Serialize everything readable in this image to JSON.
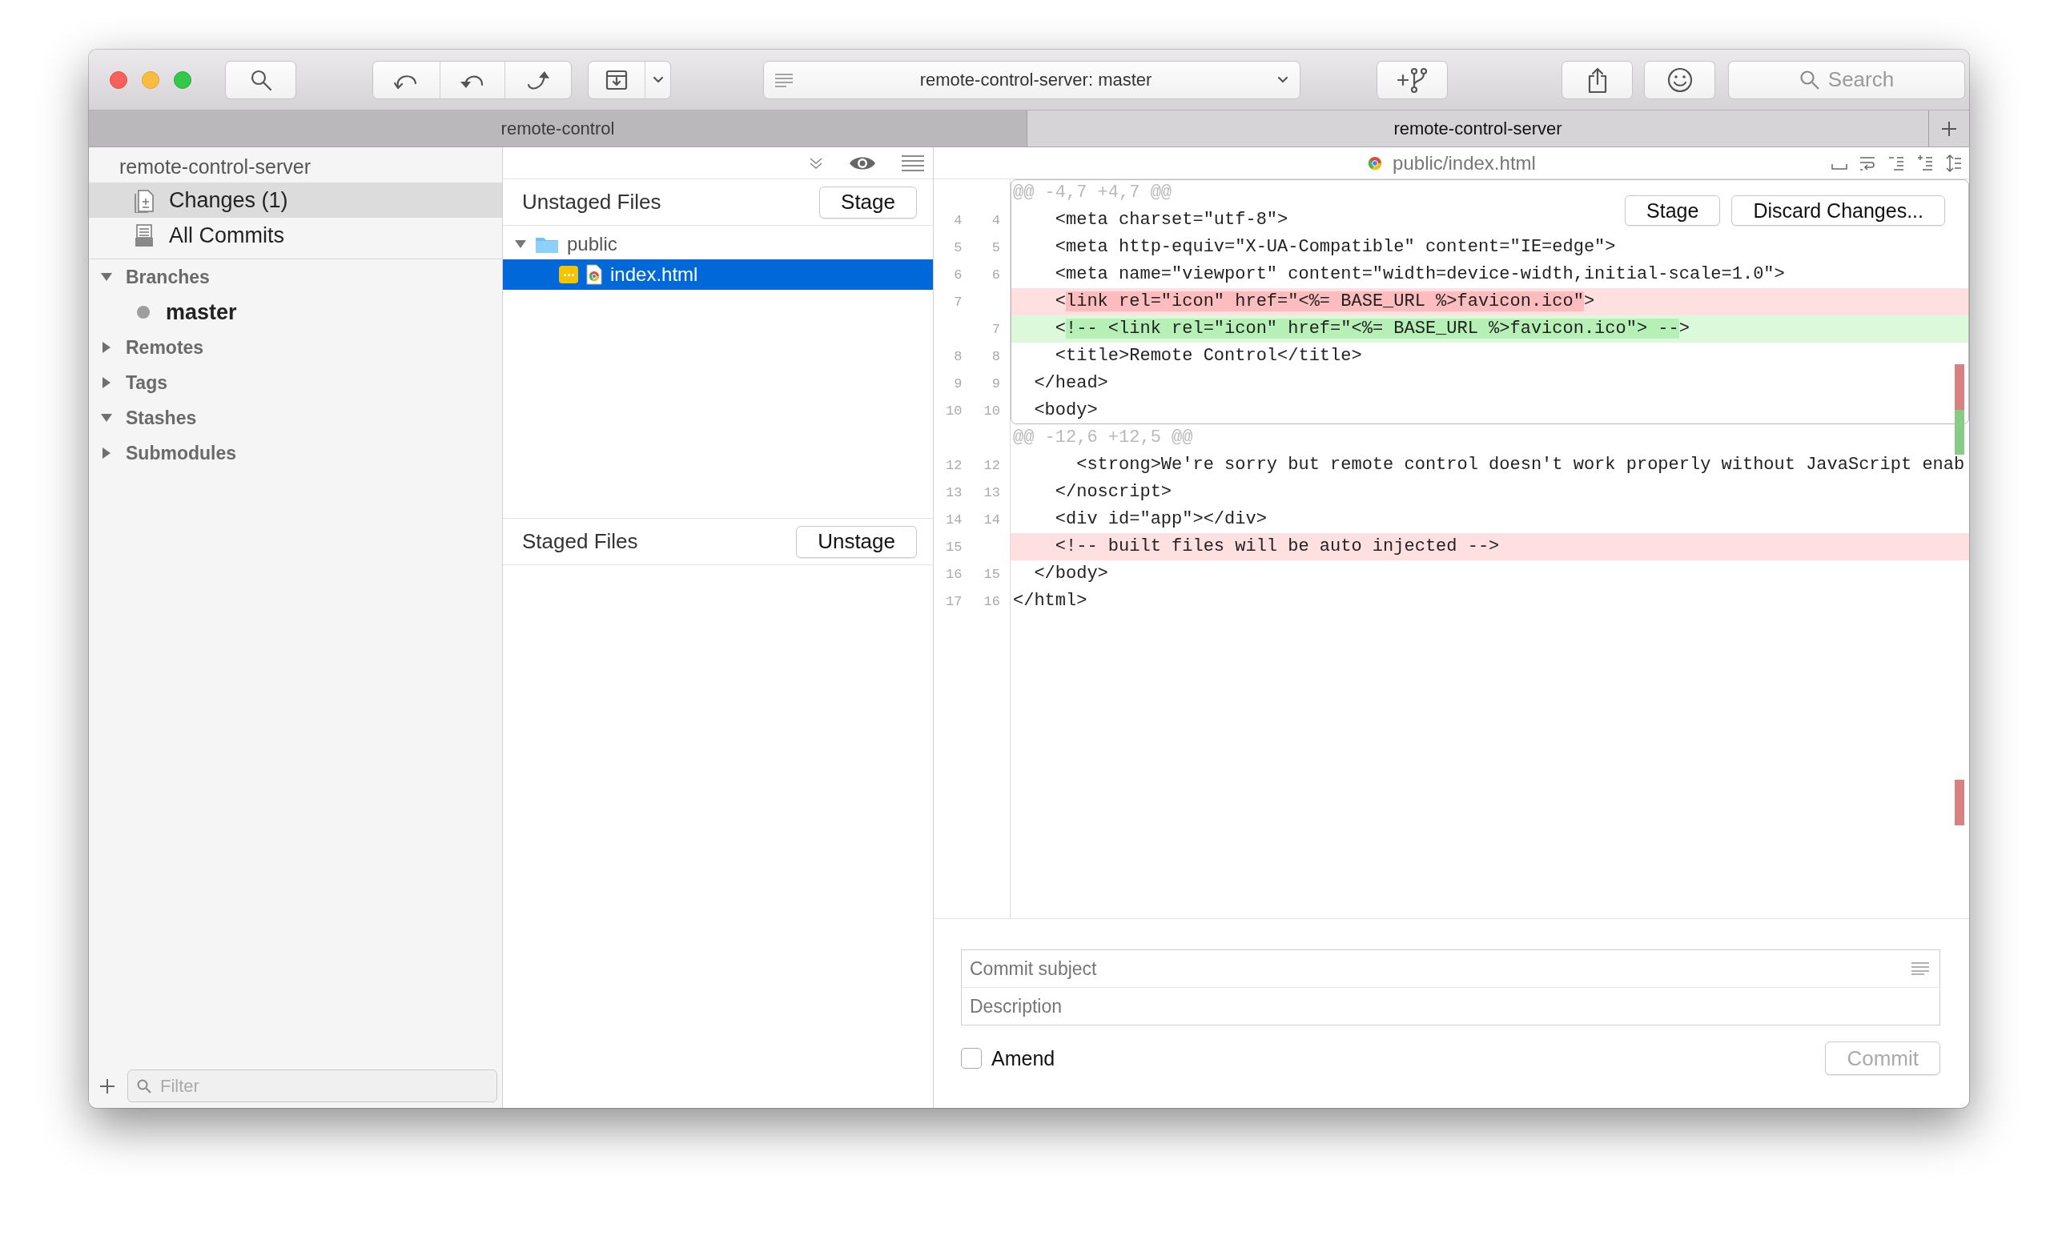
{
  "toolbar": {
    "branch_selector": "remote-control-server: master",
    "search": {
      "placeholder": "Search"
    }
  },
  "tabs": [
    {
      "label": "remote-control",
      "selected": false
    },
    {
      "label": "remote-control-server",
      "selected": true
    }
  ],
  "sidebar": {
    "repository": "remote-control-server",
    "items": [
      {
        "label": "Changes (1)",
        "kind": "changes",
        "selected": true
      },
      {
        "label": "All Commits",
        "kind": "commits",
        "selected": false
      }
    ],
    "sections": [
      {
        "label": "Branches",
        "expanded": true,
        "children": [
          {
            "label": "master",
            "current": true
          }
        ]
      },
      {
        "label": "Remotes",
        "expanded": false
      },
      {
        "label": "Tags",
        "expanded": false
      },
      {
        "label": "Stashes",
        "expanded": true
      },
      {
        "label": "Submodules",
        "expanded": false
      }
    ],
    "filter": {
      "placeholder": "Filter"
    }
  },
  "unstaged": {
    "title": "Unstaged Files",
    "button": "Stage",
    "tree": [
      {
        "label": "public",
        "kind": "folder",
        "expanded": true,
        "selected": false,
        "children": [
          {
            "label": "index.html",
            "kind": "file",
            "selected": true,
            "color": "#f5c400"
          }
        ]
      }
    ]
  },
  "staged": {
    "title": "Staged Files",
    "button": "Unstage"
  },
  "diff": {
    "file": "public/index.html",
    "hunks": [
      {
        "header": "@@ -4,7 +4,7 @@",
        "selected": true,
        "buttons": [
          "Stage",
          "Discard Changes..."
        ],
        "lines": [
          {
            "old": "4",
            "new": "4",
            "kind": "context",
            "text": "    <meta charset=\"utf-8\">"
          },
          {
            "old": "5",
            "new": "5",
            "kind": "context",
            "text": "    <meta http-equiv=\"X-UA-Compatible\" content=\"IE=edge\">"
          },
          {
            "old": "6",
            "new": "6",
            "kind": "context",
            "text": "    <meta name=\"viewport\" content=\"width=device-width,initial-scale=1.0\">"
          },
          {
            "old": "7",
            "kind": "removed",
            "parts": [
              {
                "text": "    <",
                "changed": false
              },
              {
                "text": "link rel=\"icon\" href=\"<%= BASE_URL %>favicon.ico\"",
                "changed": true
              },
              {
                "text": ">",
                "changed": false
              }
            ]
          },
          {
            "new": "7",
            "kind": "added",
            "parts": [
              {
                "text": "    <",
                "changed": false
              },
              {
                "text": "!-- <link rel=\"icon\" href=\"<%= BASE_URL %>favicon.ico\"> --",
                "changed": true
              },
              {
                "text": ">",
                "changed": false
              }
            ]
          },
          {
            "old": "8",
            "new": "8",
            "kind": "context",
            "text": "    <title>Remote Control</title>"
          },
          {
            "old": "9",
            "new": "9",
            "kind": "context",
            "text": "  </head>"
          },
          {
            "old": "10",
            "new": "10",
            "kind": "context",
            "text": "  <body>"
          }
        ]
      },
      {
        "header": "@@ -12,6 +12,5 @@",
        "selected": false,
        "lines": [
          {
            "old": "12",
            "new": "12",
            "kind": "context",
            "text": "      <strong>We're sorry but remote control doesn't work properly without JavaScript enab"
          },
          {
            "old": "13",
            "new": "13",
            "kind": "context",
            "text": "    </noscript>"
          },
          {
            "old": "14",
            "new": "14",
            "kind": "context",
            "text": "    <div id=\"app\"></div>"
          },
          {
            "old": "15",
            "kind": "removed",
            "text": "    <!-- built files will be auto injected -->"
          },
          {
            "old": "16",
            "new": "15",
            "kind": "context",
            "text": "  </body>"
          },
          {
            "old": "17",
            "new": "16",
            "kind": "context",
            "text": "</html>"
          }
        ]
      }
    ]
  },
  "commit": {
    "subject_placeholder": "Commit subject",
    "description_placeholder": "Description",
    "amend": {
      "label": "Amend",
      "checked": false
    },
    "button": {
      "label": "Commit",
      "disabled": true
    }
  }
}
